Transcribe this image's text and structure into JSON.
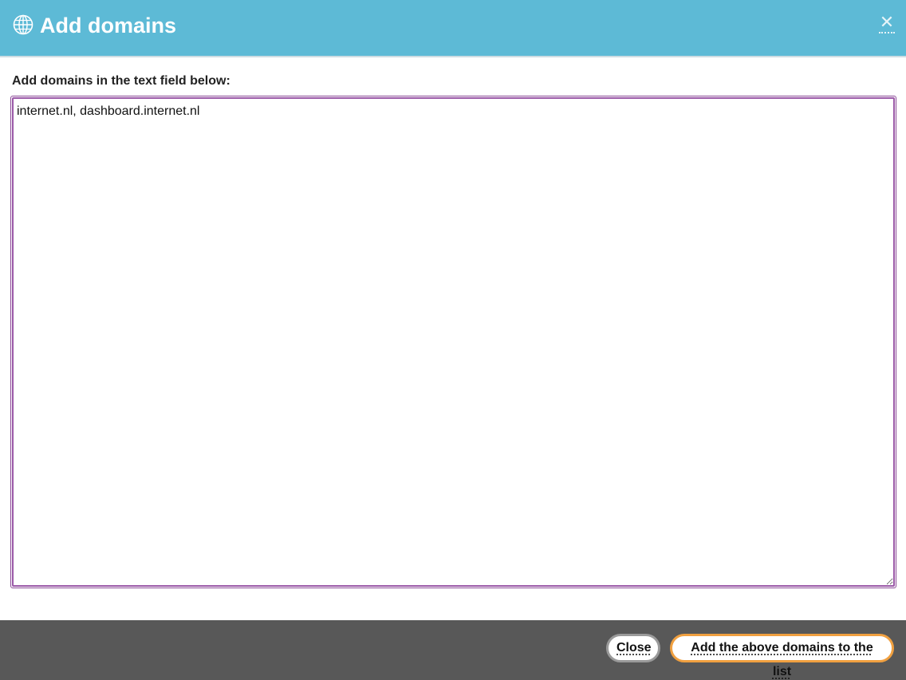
{
  "header": {
    "title": "Add domains",
    "icon": "globe-icon",
    "close_icon": "close-icon",
    "background_color": "#5dbad6"
  },
  "form": {
    "label": "Add domains in the text field below:",
    "textarea_value": "internet.nl, dashboard.internet.nl"
  },
  "footer": {
    "close_label": "Close",
    "add_label": "Add the above domains to the list",
    "background_color": "#585858",
    "add_accent": "#f0a040"
  }
}
